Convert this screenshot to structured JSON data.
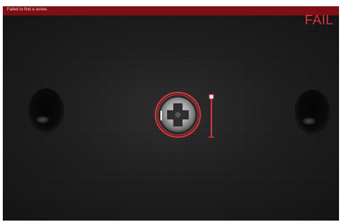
{
  "status_bar": {
    "message": "Failed to find a screw.",
    "color": "#7e0f14"
  },
  "result": {
    "label": "FAIL",
    "color": "#e0343c"
  },
  "inspection": {
    "overlay_color": "#e0343c",
    "marker_icon": "crosshair-ring-icon",
    "scale_icon": "measurement-scale-icon"
  }
}
